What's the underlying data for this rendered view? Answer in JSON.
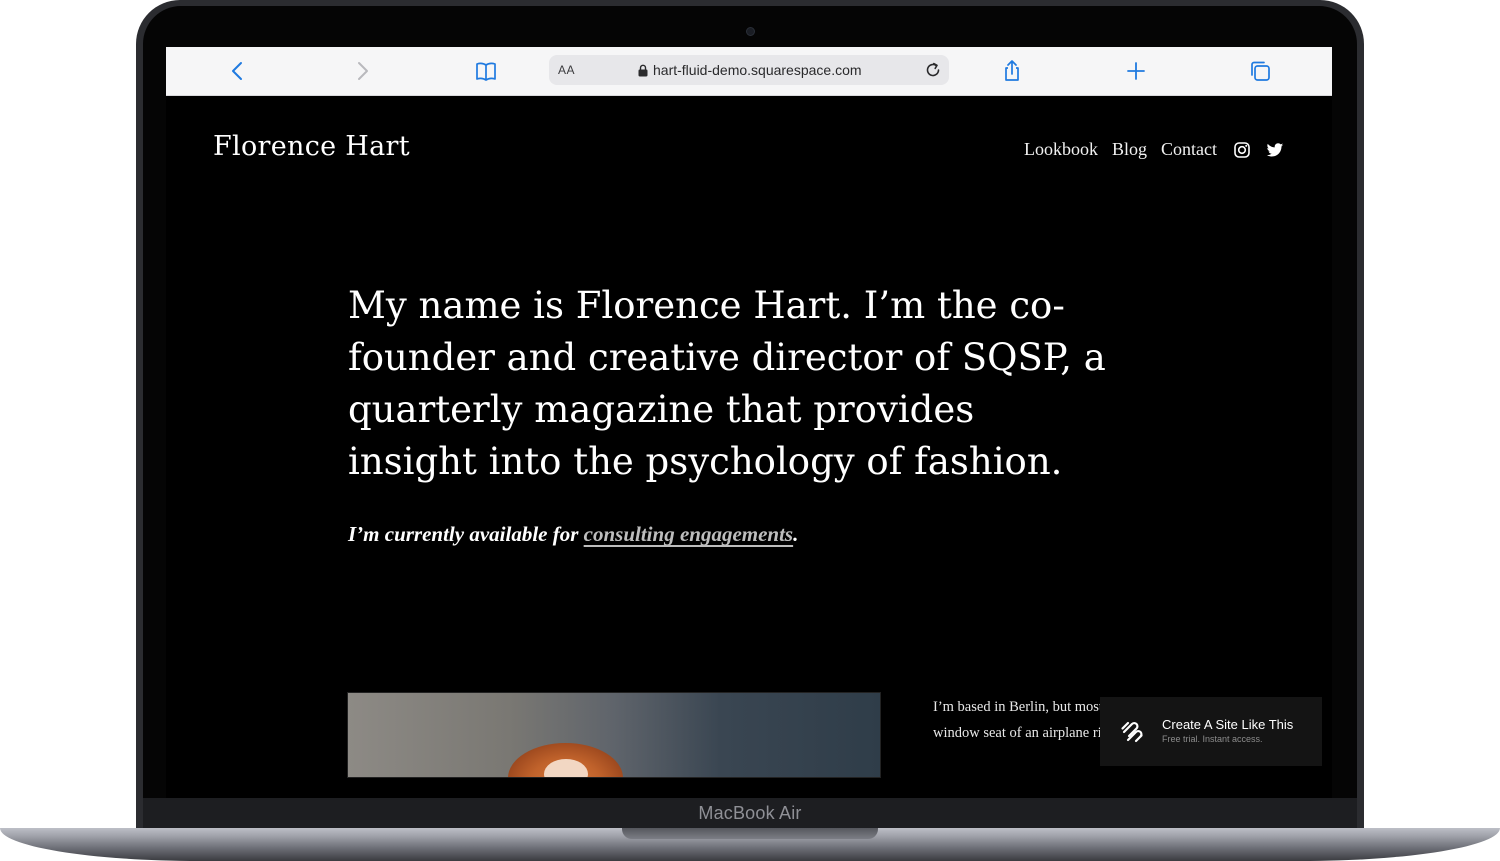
{
  "device": {
    "label": "MacBook Air"
  },
  "browser": {
    "address_prefix": "AA",
    "url": "hart-fluid-demo.squarespace.com",
    "icons": [
      "chevron-left-icon",
      "chevron-right-icon",
      "bookmarks-icon",
      "lock-icon",
      "reload-icon",
      "share-icon",
      "plus-icon",
      "tabs-icon"
    ],
    "accent": "#1f7ae0"
  },
  "site": {
    "title": "Florence Hart",
    "nav": [
      "Lookbook",
      "Blog",
      "Contact"
    ],
    "social_icons": [
      "instagram-icon",
      "twitter-icon"
    ],
    "hero_text": "My name is Florence Hart. I’m the co-founder and creative director of SQSP, a quarterly magazine that provides insight into the psychology of fashion.",
    "availability_prefix": "I’m currently available for ",
    "availability_link": "consulting engagements",
    "availability_suffix": ".",
    "bio_line1": "I’m based in Berlin, but most",
    "bio_line2": "window seat of an airplane rig"
  },
  "badge": {
    "title": "Create A Site Like This",
    "subtitle": "Free trial. Instant access."
  }
}
